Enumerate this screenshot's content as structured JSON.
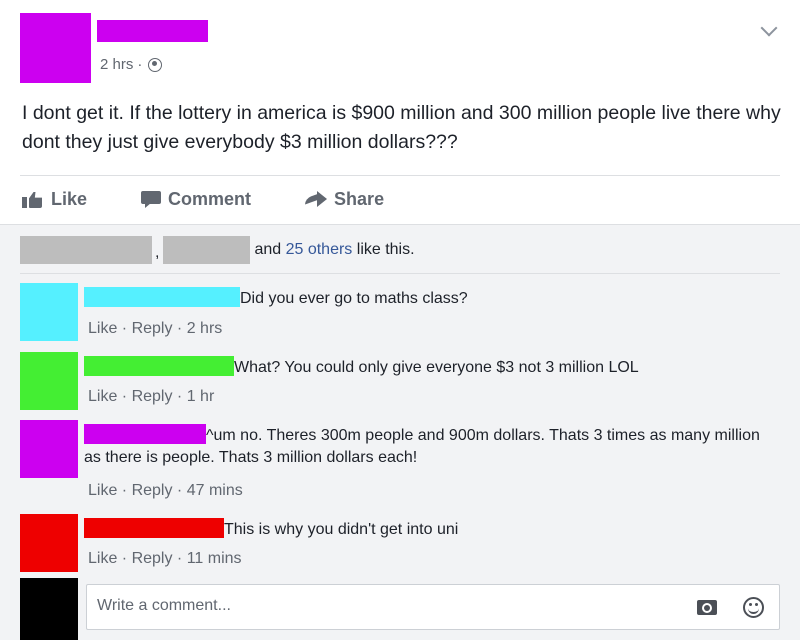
{
  "post": {
    "author_color": "#cc00f0",
    "time": "2 hrs",
    "separator": "·",
    "privacy_icon": "globe-icon",
    "menu_icon": "chevron-down-icon",
    "text": "I dont get it. If the lottery in america is $900 million and 300 million people live there why dont they just give everybody $3 million dollars???"
  },
  "actions": {
    "like": "Like",
    "comment": "Comment",
    "share": "Share"
  },
  "likes": {
    "comma": ",",
    "text_pre": "and ",
    "others_link": "25 others",
    "text_post": " like this."
  },
  "comments": [
    {
      "avatar_color": "#55f0ff",
      "name_color": "#55f0ff",
      "text": "Did you ever go to maths class?",
      "like": "Like",
      "reply": "Reply",
      "sep": " · ",
      "time": "2 hrs"
    },
    {
      "avatar_color": "#44ee33",
      "name_color": "#44ee33",
      "text": "What? You could only give everyone $3 not 3 million LOL",
      "like": "Like",
      "reply": "Reply",
      "sep": " · ",
      "time": "1 hr"
    },
    {
      "avatar_color": "#cc00f0",
      "name_color": "#cc00f0",
      "text": "^um no. Theres 300m people and 900m dollars. Thats 3 times as many million as there is people. Thats 3 million dollars each!",
      "like": "Like",
      "reply": "Reply",
      "sep": " · ",
      "time": "47 mins"
    },
    {
      "avatar_color": "#ee0000",
      "name_color": "#ee0000",
      "text": "This is why you didn't get into uni",
      "like": "Like",
      "reply": "Reply",
      "sep": " · ",
      "time": "11 mins"
    }
  ],
  "composer": {
    "placeholder": "Write a comment...",
    "avatar_color": "#000000",
    "camera_icon": "camera-icon",
    "emoji_icon": "smiley-icon"
  }
}
